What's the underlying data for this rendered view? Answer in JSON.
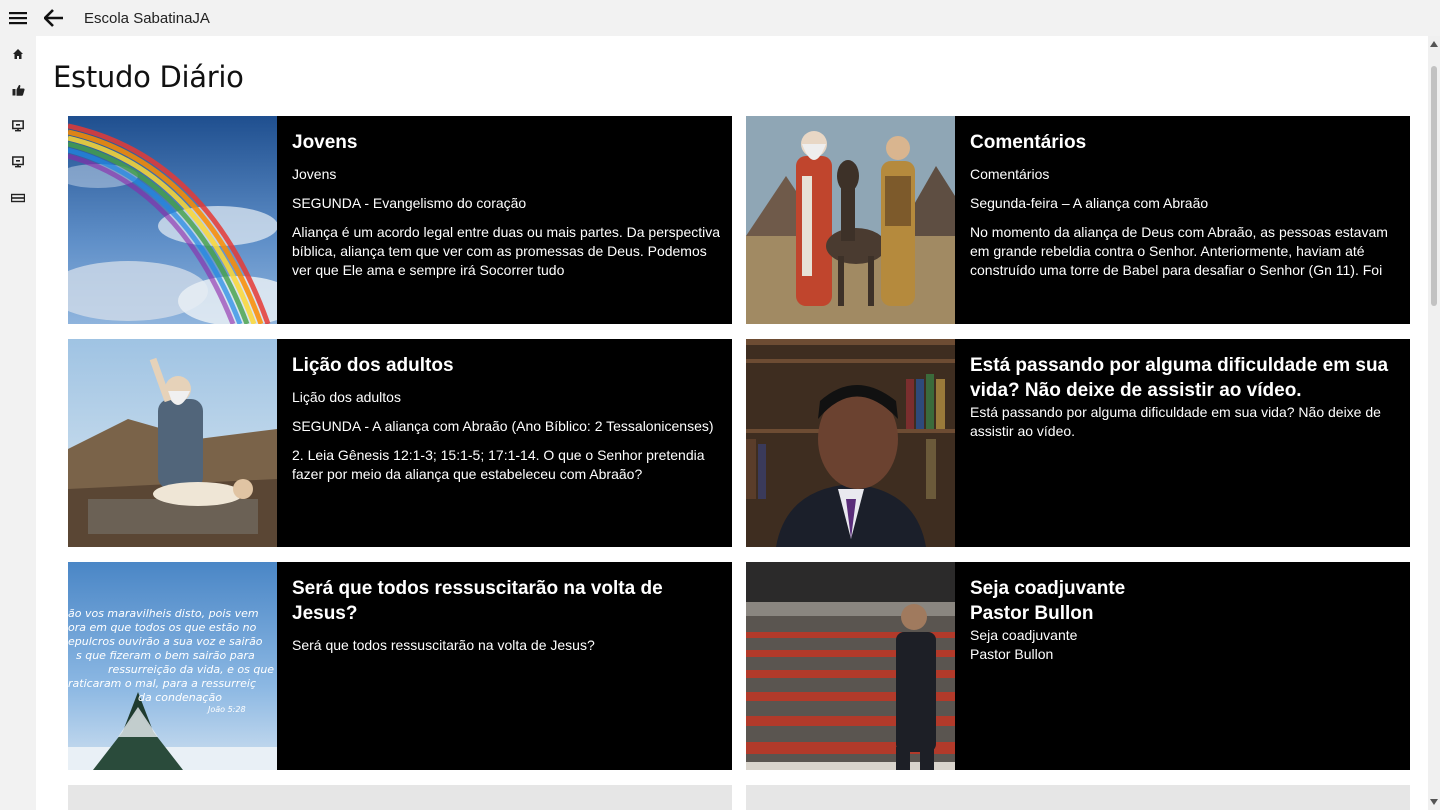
{
  "app": {
    "title": "Escola SabatinaJA"
  },
  "page": {
    "title": "Estudo Diário"
  },
  "nav": {
    "icons": [
      "menu-icon",
      "back-arrow-icon",
      "home-icon",
      "thumbs-up-icon",
      "monitor-icon",
      "monitor-icon",
      "ticket-icon"
    ]
  },
  "cards": [
    {
      "title": "Jovens",
      "lines": [
        "Jovens",
        "SEGUNDA - Evangelismo do coração",
        "Aliança é um acordo legal entre duas ou mais partes. Da perspectiva bíblica, aliança tem que ver com as promessas de Deus. Podemos ver que Ele ama e sempre irá Socorrer tudo"
      ],
      "image": "rainbow over sky"
    },
    {
      "title": "Comentários",
      "lines": [
        "Comentários",
        "Segunda-feira – A aliança com Abraão",
        "No momento da aliança de Deus com Abraão, as pessoas estavam em grande rebeldia contra o Senhor. Anteriormente, haviam até construído uma torre de Babel para desafiar o Senhor (Gn 11). Foi"
      ],
      "image": "biblical figures with donkey"
    },
    {
      "title": "Lição dos adultos",
      "lines": [
        "Lição dos adultos",
        "SEGUNDA - A aliança com Abraão (Ano Bíblico: 2 Tessalonicenses)",
        "2. Leia Gênesis 12:1-3; 15:1-5; 17:1-14. O que o Senhor pretendia fazer por meio da aliança que estabeleceu com Abraão?"
      ],
      "image": "Abraham on altar"
    },
    {
      "title": "Está passando por alguma dificuldade em sua vida? Não deixe de assistir ao vídeo.",
      "lines": [
        "Está passando por alguma dificuldade em sua vida? Não deixe de assistir ao vídeo."
      ],
      "image": "speaker in front of bookshelf"
    },
    {
      "title": "Será que todos ressuscitarão na volta de Jesus?",
      "lines": [
        "Será que todos ressuscitarão na volta de Jesus?"
      ],
      "image": "bible verse over winter tree",
      "overlay_text": [
        "ão vos maravilheis disto, pois vem",
        "ora em que todos os que estão no",
        "epulcros ouvirão a sua voz e sairão",
        "s que fizeram o bem sairão para",
        "ressurreição da vida, e os que",
        "raticaram o mal, para a ressurreiç",
        "da condenação",
        "João 5:28"
      ]
    },
    {
      "title": "Seja coadjuvante\nPastor Bullon",
      "lines": [
        "Seja coadjuvante\nPastor Bullon"
      ],
      "image": "pastor in empty stadium"
    }
  ],
  "colors": {
    "card_bg": "#000000",
    "page_bg": "#ffffff",
    "chrome_bg": "#f2f2f2"
  }
}
